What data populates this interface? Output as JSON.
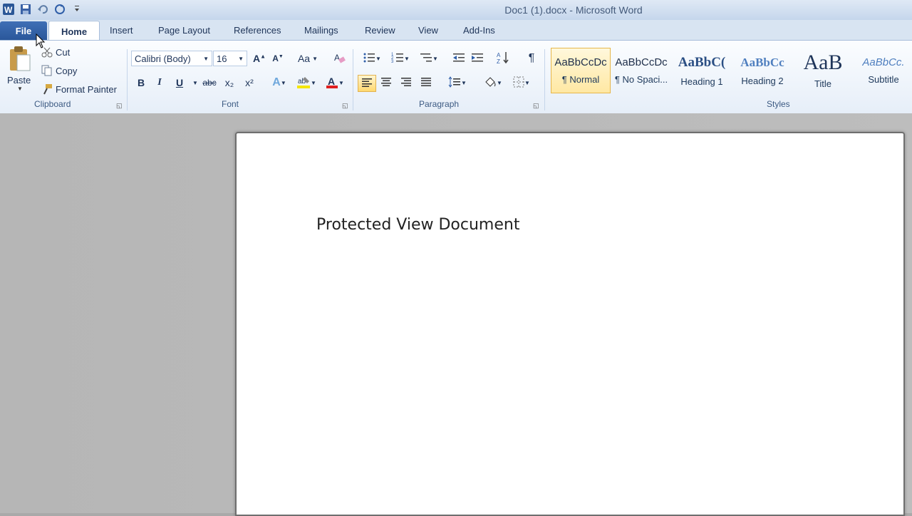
{
  "window": {
    "title": "Doc1 (1).docx - Microsoft Word"
  },
  "qat": {
    "icons": [
      "word-logo-icon",
      "save-icon",
      "undo-icon",
      "redo-icon",
      "customize-icon"
    ]
  },
  "tabs": {
    "file": "File",
    "home": "Home",
    "insert": "Insert",
    "page_layout": "Page Layout",
    "references": "References",
    "mailings": "Mailings",
    "review": "Review",
    "view": "View",
    "addins": "Add-Ins"
  },
  "clipboard": {
    "paste": "Paste",
    "cut": "Cut",
    "copy": "Copy",
    "format_painter": "Format Painter",
    "label": "Clipboard"
  },
  "font": {
    "name": "Calibri (Body)",
    "size": "16",
    "label": "Font",
    "bold": "B",
    "italic": "I",
    "underline": "U",
    "strike": "abc",
    "subscript": "x₂",
    "superscript": "x²",
    "change_case": "Aa"
  },
  "paragraph": {
    "label": "Paragraph"
  },
  "styles": {
    "label": "Styles",
    "items": [
      {
        "sample": "AaBbCcDc",
        "name": "¶ Normal"
      },
      {
        "sample": "AaBbCcDc",
        "name": "¶ No Spaci..."
      },
      {
        "sample": "AaBbC(",
        "name": "Heading 1"
      },
      {
        "sample": "AaBbCc",
        "name": "Heading 2"
      },
      {
        "sample": "AaB",
        "name": "Title"
      },
      {
        "sample": "AaBbCc.",
        "name": "Subtitle"
      }
    ]
  },
  "document": {
    "text": "Protected View Document"
  },
  "colors": {
    "accent": "#2a579a",
    "highlight": "#ffe8a3",
    "font_color": "#e02020",
    "highlight_color": "#f5e600"
  }
}
